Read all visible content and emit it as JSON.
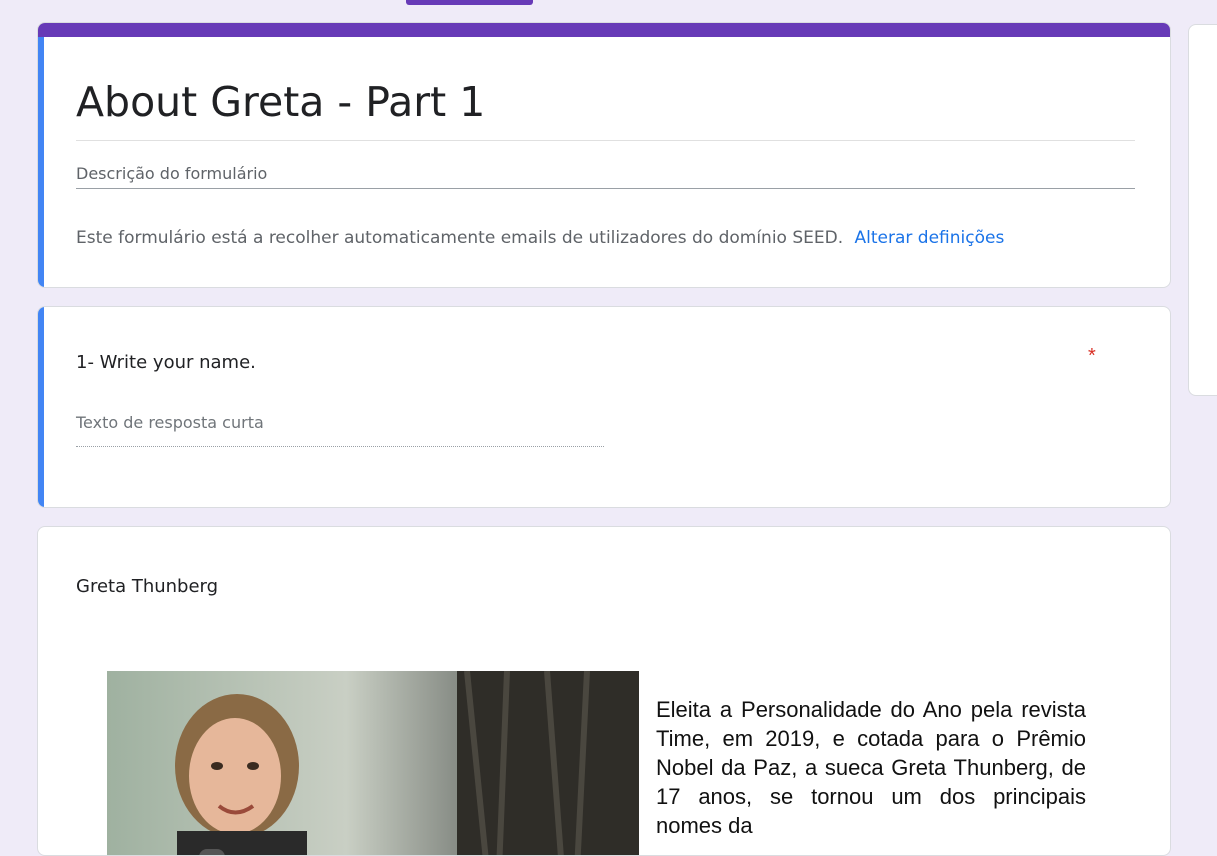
{
  "form": {
    "title": "About Greta - Part 1",
    "description_placeholder": "Descrição do formulário",
    "notice_text": "Este formulário está a recolher automaticamente emails de utilizadores do domínio SEED.",
    "notice_link": "Alterar definições"
  },
  "question": {
    "title": "1- Write your name.",
    "required_mark": "*",
    "answer_placeholder": "Texto de resposta curta"
  },
  "section": {
    "title": "Greta Thunberg",
    "article_text": "Eleita a Personalidade do Ano pela revista Time, em 2019, e cotada para o Prêmio Nobel da Paz, a sueca Greta Thunberg, de 17 anos, se tornou um dos principais nomes da"
  },
  "colors": {
    "theme": "#673ab7",
    "accent": "#4285f4",
    "background": "#efebf8",
    "link": "#1a73e8",
    "required": "#d93025"
  }
}
